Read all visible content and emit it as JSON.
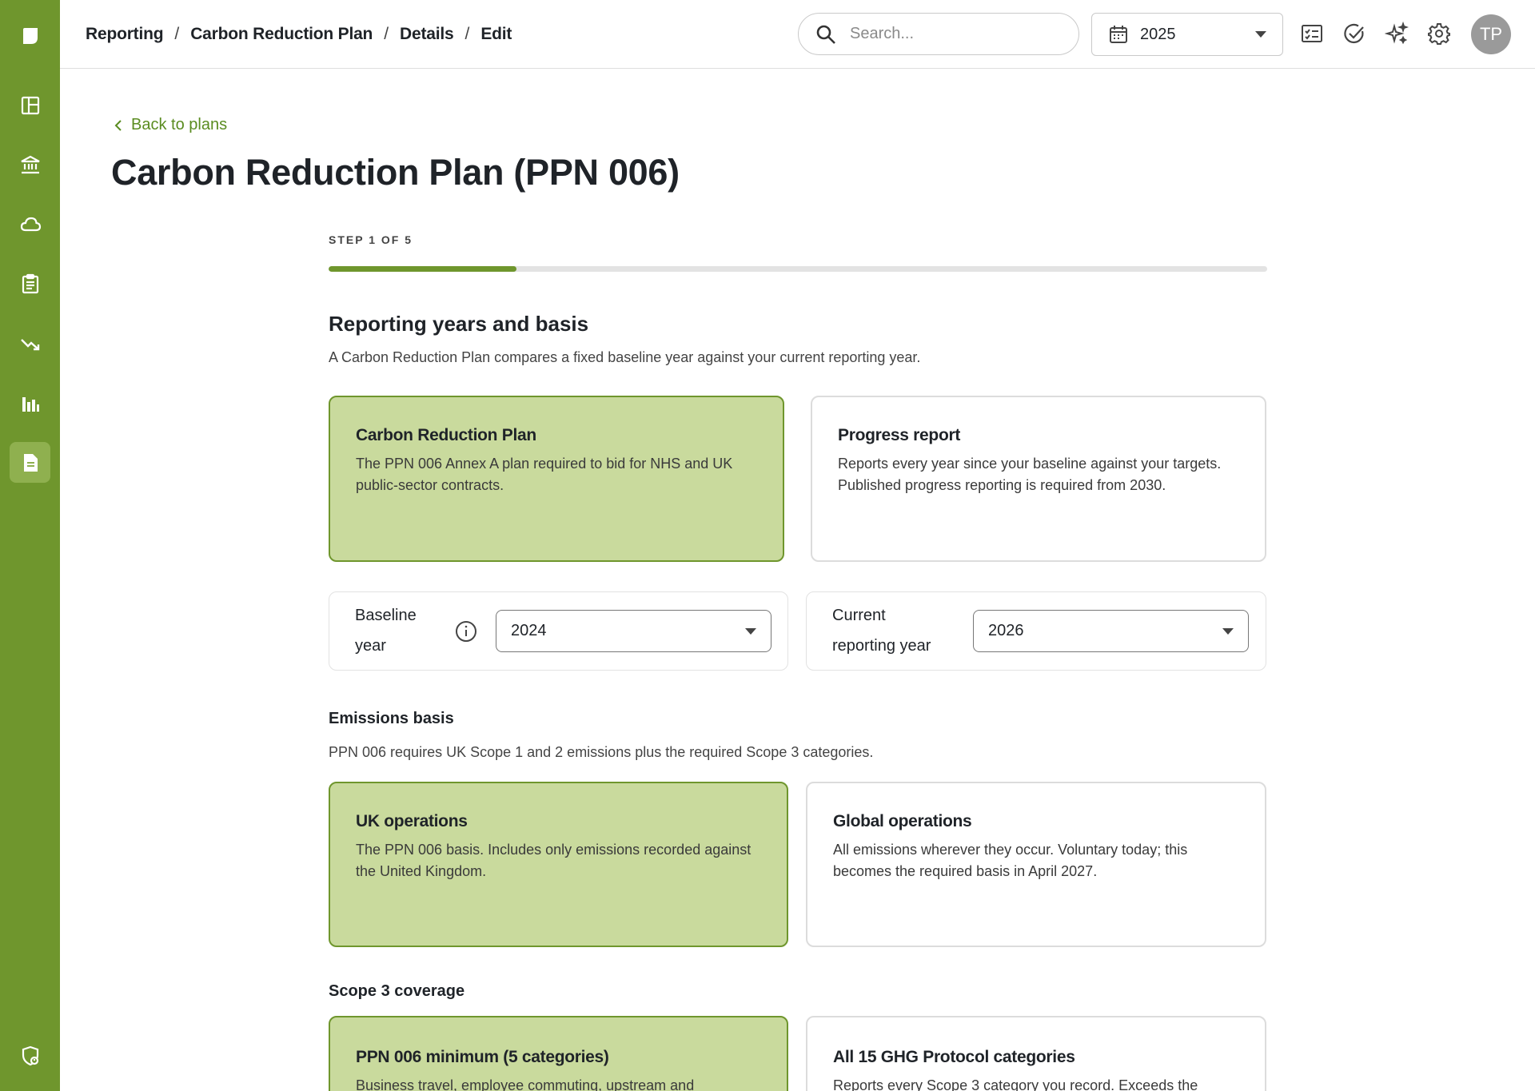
{
  "colors": {
    "brand_green": "#6f962d",
    "selected_card_bg": "#c9da9d",
    "link_green": "#5a8c20"
  },
  "sidebar": {
    "items": [
      {
        "name": "logo-icon"
      },
      {
        "name": "dashboard-icon"
      },
      {
        "name": "bank-icon"
      },
      {
        "name": "cloud-icon"
      },
      {
        "name": "clipboard-icon"
      },
      {
        "name": "trending-down-icon"
      },
      {
        "name": "bar-chart-icon"
      },
      {
        "name": "document-icon",
        "active": true
      },
      {
        "name": "shield-user-icon"
      }
    ]
  },
  "breadcrumb": {
    "items": [
      "Reporting",
      "Carbon Reduction Plan",
      "Details",
      "Edit"
    ],
    "separator": "/"
  },
  "search": {
    "placeholder": "Search..."
  },
  "year_selector": {
    "value": "2025"
  },
  "toolbar_icons": [
    "checklist-icon",
    "check-circle-icon",
    "sparkles-icon",
    "gear-icon"
  ],
  "user": {
    "initials": "TP"
  },
  "back_link": "Back to plans",
  "page_title": "Carbon Reduction Plan (PPN 006)",
  "step": {
    "label": "STEP 1 OF 5",
    "current": 1,
    "total": 5,
    "progress": 0.2
  },
  "reporting": {
    "title": "Reporting years and basis",
    "description": "A Carbon Reduction Plan compares a fixed baseline year against your current reporting year.",
    "plan_types": [
      {
        "title": "Carbon Reduction Plan",
        "description": "The PPN 006 Annex A plan required to bid for NHS and UK public-sector contracts.",
        "selected": true
      },
      {
        "title": "Progress report",
        "description": "Reports every year since your baseline against your targets. Published progress reporting is required from 2030.",
        "selected": false
      }
    ],
    "baseline_year": {
      "label": "Baseline year",
      "value": "2024"
    },
    "current_year": {
      "label": "Current reporting year",
      "value": "2026"
    }
  },
  "emissions_basis": {
    "title": "Emissions basis",
    "description": "PPN 006 requires UK Scope 1 and 2 emissions plus the required Scope 3 categories.",
    "options": [
      {
        "title": "UK operations",
        "description": "The PPN 006 basis. Includes only emissions recorded against the United Kingdom.",
        "selected": true
      },
      {
        "title": "Global operations",
        "description": "All emissions wherever they occur. Voluntary today; this becomes the required basis in April 2027.",
        "selected": false
      }
    ]
  },
  "scope3": {
    "title": "Scope 3 coverage",
    "options": [
      {
        "title": "PPN 006 minimum (5 categories)",
        "description": "Business travel, employee commuting, upstream and",
        "selected": true
      },
      {
        "title": "All 15 GHG Protocol categories",
        "description": "Reports every Scope 3 category you record. Exceeds the",
        "selected": false
      }
    ]
  }
}
